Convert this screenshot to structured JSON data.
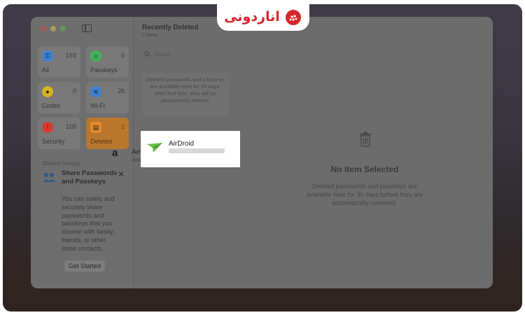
{
  "brand": {
    "name": "اناردونی",
    "color": "#d6262c"
  },
  "sidebar": {
    "tiles": [
      {
        "count": "193",
        "label": "All",
        "icon": "key-icon",
        "color": "#3b82d6"
      },
      {
        "count": "0",
        "label": "Passkeys",
        "icon": "person-key-icon",
        "color": "#3eb455"
      },
      {
        "count": "0",
        "label": "Codes",
        "icon": "lock-icon",
        "color": "#d6b21e"
      },
      {
        "count": "26",
        "label": "Wi-Fi",
        "icon": "wifi-icon",
        "color": "#3b82d6"
      },
      {
        "count": "109",
        "label": "Security",
        "icon": "exclamation-icon",
        "color": "#d93b30"
      },
      {
        "count": "2",
        "label": "Deleted",
        "icon": "trash-icon",
        "color": "#e48a2a"
      }
    ],
    "shared_title": "Shared Groups",
    "share_card": {
      "heading": "Share Passwords and Passkeys",
      "body": "You can safely and securely share passwords and passkeys that you choose with family, friends, or other close contacts.",
      "button": "Get Started"
    }
  },
  "list": {
    "title": "Recently Deleted",
    "subtitle": "2 items",
    "search_placeholder": "Search",
    "note": "Deleted passwords and passkeys are available here for 30 days. After that time, they will be permanently deleted.",
    "items": [
      {
        "name": "AirDroid"
      },
      {
        "name": "Amazon.com.au"
      }
    ]
  },
  "detail": {
    "title": "No Item Selected",
    "description": "Deleted passwords and passkeys are available here for 30 days before they are automatically removed."
  }
}
